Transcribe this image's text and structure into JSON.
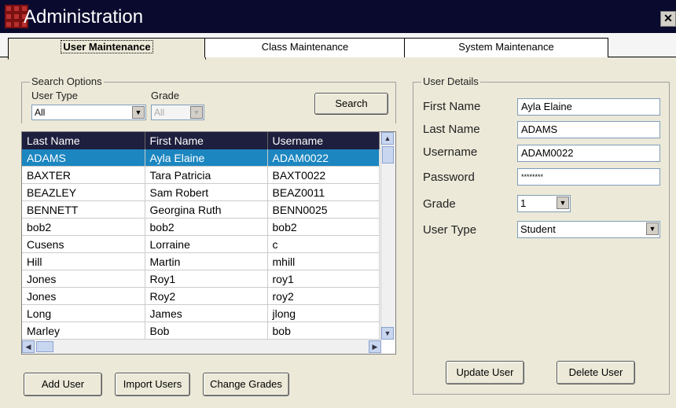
{
  "window": {
    "title": "Administration",
    "close_glyph": "✕"
  },
  "tabs": [
    {
      "label": "User Maintenance",
      "active": true
    },
    {
      "label": "Class Maintenance",
      "active": false
    },
    {
      "label": "System Maintenance",
      "active": false
    }
  ],
  "search": {
    "legend": "Search Options",
    "user_type_label": "User Type",
    "user_type_value": "All",
    "grade_label": "Grade",
    "grade_value": "All",
    "grade_disabled": true,
    "search_button": "Search"
  },
  "grid": {
    "columns": [
      "Last Name",
      "First Name",
      "Username"
    ],
    "selected_index": 0,
    "rows": [
      [
        "ADAMS",
        "Ayla Elaine",
        "ADAM0022"
      ],
      [
        "BAXTER",
        "Tara Patricia",
        "BAXT0022"
      ],
      [
        "BEAZLEY",
        "Sam Robert",
        "BEAZ0011"
      ],
      [
        "BENNETT",
        "Georgina Ruth",
        "BENN0025"
      ],
      [
        "bob2",
        "bob2",
        "bob2"
      ],
      [
        "Cusens",
        "Lorraine",
        "c"
      ],
      [
        "Hill",
        "Martin",
        "mhill"
      ],
      [
        "Jones",
        "Roy1",
        "roy1"
      ],
      [
        "Jones",
        "Roy2",
        "roy2"
      ],
      [
        "Long",
        "James",
        "jlong"
      ],
      [
        "Marley",
        "Bob",
        "bob"
      ]
    ]
  },
  "actions": {
    "add_user": "Add User",
    "import_users": "Import Users",
    "change_grades": "Change Grades"
  },
  "details": {
    "legend": "User Details",
    "first_name_label": "First Name",
    "first_name_value": "Ayla Elaine",
    "last_name_label": "Last Name",
    "last_name_value": "ADAMS",
    "username_label": "Username",
    "username_value": "ADAM0022",
    "password_label": "Password",
    "password_value": "********",
    "grade_label": "Grade",
    "grade_value": "1",
    "user_type_label": "User Type",
    "user_type_value": "Student",
    "update_button": "Update User",
    "delete_button": "Delete User"
  },
  "icons": {
    "close": "close-icon",
    "dropdown": "chevron-down-icon",
    "scroll_up": "arrow-up-icon",
    "scroll_down": "arrow-down-icon",
    "scroll_left": "arrow-left-icon",
    "scroll_right": "arrow-right-icon"
  },
  "colors": {
    "titlebar": "#0a0a2e",
    "grid_header": "#1e1e3e",
    "selection": "#1c86c0",
    "window_bg": "#ece9d8"
  }
}
